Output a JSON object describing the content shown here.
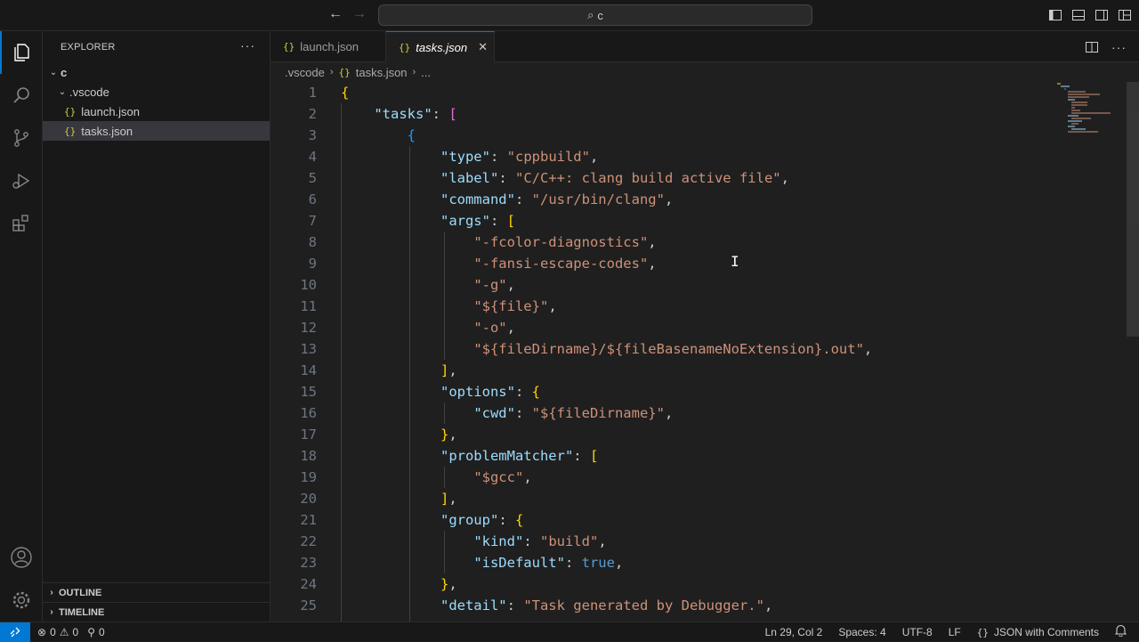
{
  "titlebar": {
    "search_text": "c",
    "back_icon": "arrow-left",
    "forward_icon": "arrow-right"
  },
  "activity_bar": {
    "items": [
      "explorer",
      "search",
      "source-control",
      "run-and-debug",
      "extensions"
    ],
    "bottom": [
      "accounts",
      "manage"
    ]
  },
  "sidebar": {
    "title": "EXPLORER",
    "more": "···",
    "root": "c",
    "folder": ".vscode",
    "files": [
      "launch.json",
      "tasks.json"
    ],
    "json_glyph": "{}",
    "outline": "OUTLINE",
    "timeline": "TIMELINE"
  },
  "tabs": {
    "inactive": "launch.json",
    "active": "tasks.json",
    "close": "✕",
    "json_glyph": "{}"
  },
  "breadcrumb": {
    "folder": ".vscode",
    "file": "tasks.json",
    "more": "..."
  },
  "editor": {
    "lines": [
      {
        "n": "1"
      },
      {
        "n": "2"
      },
      {
        "n": "3"
      },
      {
        "n": "4"
      },
      {
        "n": "5"
      },
      {
        "n": "6"
      },
      {
        "n": "7"
      },
      {
        "n": "8"
      },
      {
        "n": "9"
      },
      {
        "n": "10"
      },
      {
        "n": "11"
      },
      {
        "n": "12"
      },
      {
        "n": "13"
      },
      {
        "n": "14"
      },
      {
        "n": "15"
      },
      {
        "n": "16"
      },
      {
        "n": "17"
      },
      {
        "n": "18"
      },
      {
        "n": "19"
      },
      {
        "n": "20"
      },
      {
        "n": "21"
      },
      {
        "n": "22"
      },
      {
        "n": "23"
      },
      {
        "n": "24"
      },
      {
        "n": "25"
      }
    ],
    "code": {
      "tasks_key": "\"tasks\"",
      "type_key": "\"type\"",
      "type_val": "\"cppbuild\"",
      "label_key": "\"label\"",
      "label_val": "\"C/C++: clang build active file\"",
      "command_key": "\"command\"",
      "command_val": "\"/usr/bin/clang\"",
      "args_key": "\"args\"",
      "arg1": "\"-fcolor-diagnostics\"",
      "arg2": "\"-fansi-escape-codes\"",
      "arg3": "\"-g\"",
      "arg4": "\"${file}\"",
      "arg5": "\"-o\"",
      "arg6": "\"${fileDirname}/${fileBasenameNoExtension}.out\"",
      "options_key": "\"options\"",
      "cwd_key": "\"cwd\"",
      "cwd_val": "\"${fileDirname}\"",
      "pm_key": "\"problemMatcher\"",
      "pm_val": "\"$gcc\"",
      "group_key": "\"group\"",
      "kind_key": "\"kind\"",
      "kind_val": "\"build\"",
      "isdefault_key": "\"isDefault\"",
      "isdefault_val": "true",
      "detail_key": "\"detail\"",
      "detail_val": "\"Task generated by Debugger.\""
    }
  },
  "statusbar": {
    "errors": "0",
    "warnings": "0",
    "ports": "0",
    "position": "Ln 29, Col 2",
    "spaces": "Spaces: 4",
    "encoding": "UTF-8",
    "eol": "LF",
    "language_glyph": "{}",
    "language": "JSON with Comments"
  },
  "colors": {
    "accent": "#0078d4",
    "key": "#9cdcfe",
    "string": "#ce9178",
    "bracket1": "#ffd700",
    "bracket2": "#da70d6",
    "bracket3": "#179fff",
    "literal": "#569cd6"
  }
}
